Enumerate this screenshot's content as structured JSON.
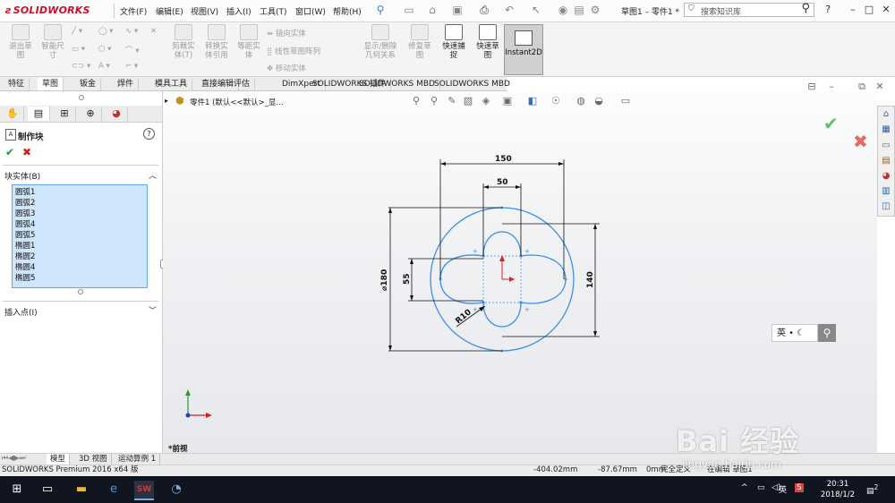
{
  "app": {
    "logo": "SOLIDWORKS",
    "doc_title": "草图1 – 零件1 *"
  },
  "menu": [
    "文件(F)",
    "编辑(E)",
    "视图(V)",
    "插入(I)",
    "工具(T)",
    "窗口(W)",
    "帮助(H)"
  ],
  "search": {
    "placeholder": "搜索知识库"
  },
  "window_controls": {
    "help": "?",
    "minimize": "–",
    "restore": "□",
    "close": "✕"
  },
  "ribbon": {
    "items": [
      {
        "label": "退出草\n图"
      },
      {
        "label": "智能尺\n寸"
      },
      {
        "label": "剪裁实\n体(T)"
      },
      {
        "label": "转换实\n体引用"
      },
      {
        "label": "等距实\n体"
      },
      {
        "label": "显示/删除\n几何关系"
      },
      {
        "label": "修复草\n图"
      },
      {
        "label": "快速捕\n捉"
      },
      {
        "label": "快速草\n图"
      }
    ],
    "small": [
      "镜向实体",
      "线性草图阵列",
      "移动实体"
    ],
    "instant2d": "Instant2D"
  },
  "tabs": [
    "特征",
    "草图",
    "钣金",
    "焊件",
    "模具工具",
    "直接编辑",
    "评估",
    "DimXpert",
    "SOLIDWORKS 插件",
    "SOLIDWORKS MBD"
  ],
  "active_tab": "草图",
  "property_manager": {
    "title": "制作块",
    "section_blocks": "块实体(B)",
    "entities": [
      "圆弧1",
      "圆弧2",
      "圆弧3",
      "圆弧4",
      "圆弧5",
      "椭圆1",
      "椭圆2",
      "椭圆4",
      "椭圆5"
    ],
    "section_insert": "插入点(I)"
  },
  "breadcrumb": "零件1 (默认<<默认>_显...",
  "view_label": "*前视",
  "ime": {
    "label": "英"
  },
  "dimensions": {
    "width_outer": "150",
    "width_inner": "50",
    "diameter": "⌀180",
    "height_inner": "55",
    "height_outer": "140",
    "radius": "R10"
  },
  "bottom_tabs": [
    "模型",
    "3D 视图",
    "运动算例 1"
  ],
  "status": {
    "product": "SOLIDWORKS Premium 2016 x64 版",
    "x": "-404.02mm",
    "y": "-87.67mm",
    "z": "0mm",
    "state": "完全定义",
    "editing": "在编辑 草图1"
  },
  "taskbar": {
    "time": "20:31",
    "date": "2018/1/2",
    "ime": "英",
    "notifications": "2"
  },
  "watermark": {
    "text": "Bai 经验",
    "url": "jingyan.baidu.com"
  },
  "colors": {
    "sketch_blue": "#3a8ee6",
    "dimension": "#111111",
    "ok_green": "#1f9a2a",
    "cancel_red": "#d0201a",
    "logo_red": "#c8102e"
  }
}
